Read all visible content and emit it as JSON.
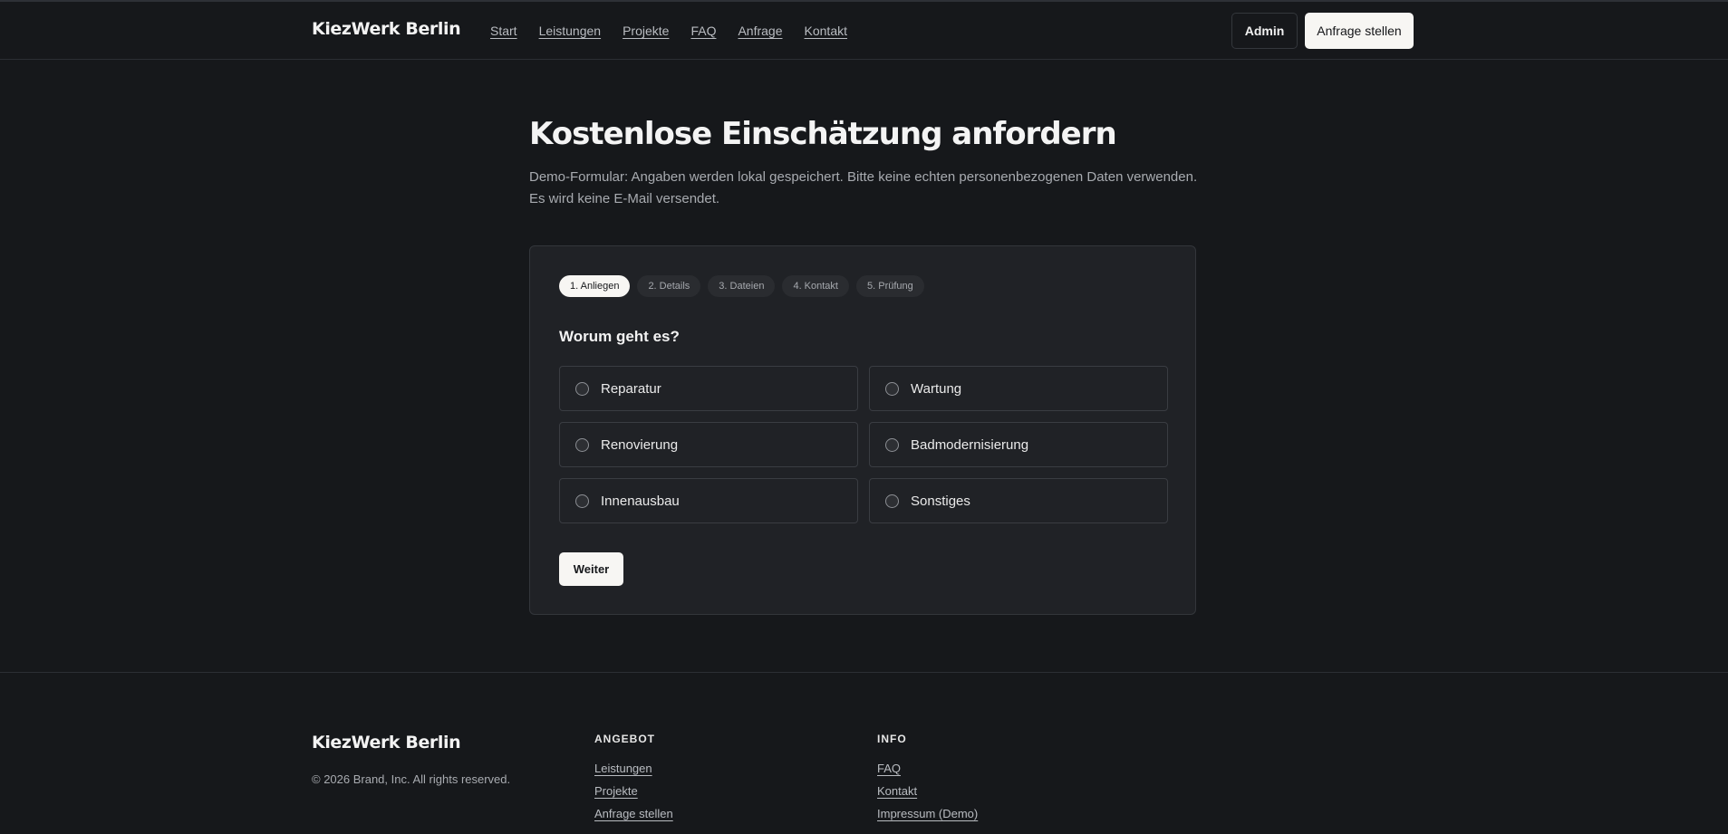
{
  "brand": "KiezWerk Berlin",
  "nav": {
    "items": [
      "Start",
      "Leistungen",
      "Projekte",
      "FAQ",
      "Anfrage",
      "Kontakt"
    ],
    "admin_label": "Admin",
    "cta_label": "Anfrage stellen"
  },
  "page": {
    "title": "Kostenlose Einschätzung anfordern",
    "intro_line1": "Demo-Formular: Angaben werden lokal gespeichert. Bitte keine echten personenbezogenen Daten verwenden.",
    "intro_line2": "Es wird keine E-Mail versendet."
  },
  "form": {
    "steps": [
      "1. Anliegen",
      "2. Details",
      "3. Dateien",
      "4. Kontakt",
      "5. Prüfung"
    ],
    "active_step": 0,
    "question": "Worum geht es?",
    "options": [
      "Reparatur",
      "Wartung",
      "Renovierung",
      "Badmodernisierung",
      "Innenausbau",
      "Sonstiges"
    ],
    "next_label": "Weiter"
  },
  "footer": {
    "brand": "KiezWerk Berlin",
    "copyright": "© 2026 Brand, Inc. All rights reserved.",
    "col1": {
      "title": "ANGEBOT",
      "links": [
        "Leistungen",
        "Projekte",
        "Anfrage stellen"
      ]
    },
    "col2": {
      "title": "INFO",
      "links": [
        "FAQ",
        "Kontakt",
        "Impressum (Demo)"
      ]
    }
  }
}
